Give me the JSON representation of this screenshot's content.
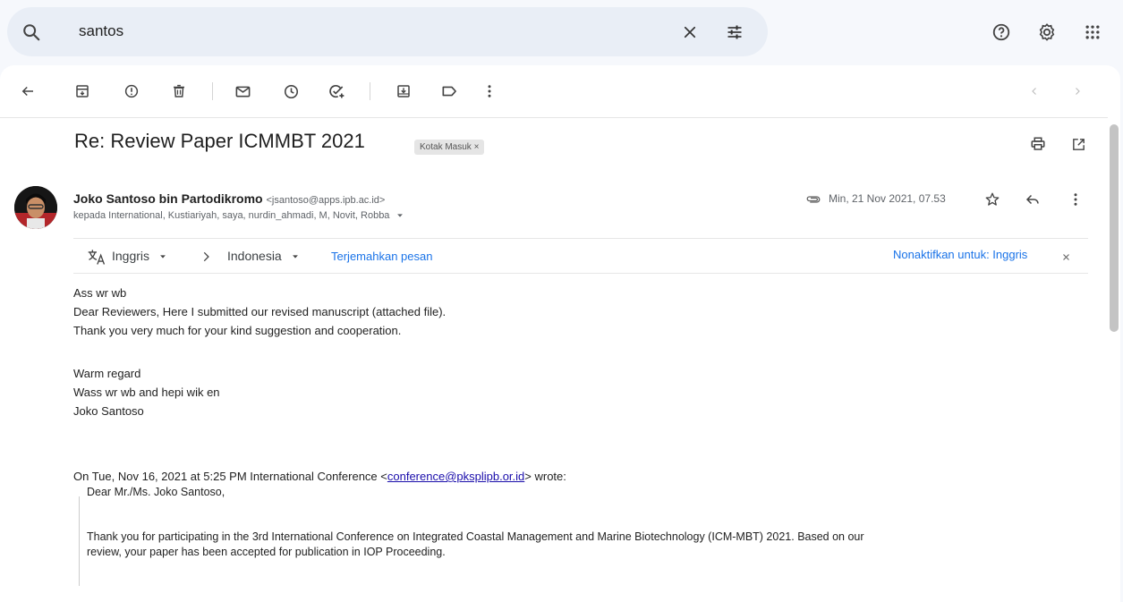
{
  "search": {
    "query": "santos"
  },
  "message": {
    "subject": "Re: Review Paper ICMMBT 2021",
    "label": "Kotak Masuk ×",
    "sender_name": "Joko Santoso bin Partodikromo",
    "sender_email": "<jsantoso@apps.ipb.ac.id>",
    "recipients": "kepada International, Kustiariyah, saya, nurdin_ahmadi, M, Novit, Robba",
    "datetime": "Min, 21 Nov 2021, 07.53"
  },
  "translate": {
    "from_lang": "Inggris",
    "to_lang": "Indonesia",
    "translate_link": "Terjemahkan pesan",
    "disable_link": "Nonaktifkan untuk: Inggris"
  },
  "body": {
    "lines": [
      "Ass wr wb",
      "Dear Reviewers, Here I submitted our revised manuscript (attached file).",
      "Thank you very much for your kind suggestion and cooperation.",
      "Warm regard",
      "Wass wr wb and hepi wik en",
      "Joko Santoso"
    ],
    "quote_header_prefix": "On Tue, Nov 16, 2021 at 5:25 PM International Conference <",
    "quote_header_email": "conference@pksplipb.or.id",
    "quote_header_suffix": "> wrote:",
    "quote_lines": [
      "Dear Mr./Ms. Joko Santoso,",
      "Thank you for participating in the 3rd International Conference on Integrated Coastal Management and Marine Biotechnology (ICM-MBT) 2021. Based on our",
      "review, your paper has been accepted for publication in IOP Proceeding."
    ]
  },
  "icons": {
    "top": [
      "search-icon",
      "clear-icon",
      "search-options-icon",
      "help-icon",
      "settings-icon",
      "apps-icon"
    ],
    "toolbar": [
      "back-icon",
      "archive-icon",
      "report-spam-icon",
      "delete-icon",
      "mark-unread-icon",
      "snooze-icon",
      "add-to-tasks-icon",
      "move-to-icon",
      "label-icon",
      "more-icon",
      "prev-icon",
      "next-icon"
    ],
    "message": [
      "print-icon",
      "open-new-window-icon",
      "attachment-icon",
      "star-icon",
      "reply-icon",
      "message-more-icon",
      "translate-icon",
      "caret-down-icon"
    ]
  },
  "colors": {
    "link": "#1a73e8",
    "background": "#f6f8fc",
    "search_bg": "#e9eef6"
  }
}
